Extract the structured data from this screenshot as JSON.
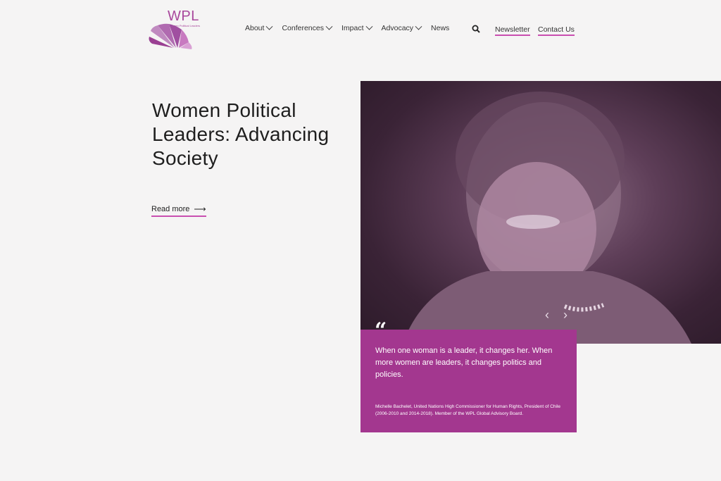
{
  "logo": {
    "text": "WPL",
    "subtitle": "Women Political Leaders",
    "brand_color": "#a8479c"
  },
  "nav": {
    "items": [
      {
        "label": "About",
        "has_dropdown": true
      },
      {
        "label": "Conferences",
        "has_dropdown": true
      },
      {
        "label": "Impact",
        "has_dropdown": true
      },
      {
        "label": "Advocacy",
        "has_dropdown": true
      },
      {
        "label": "News",
        "has_dropdown": false
      }
    ],
    "newsletter": "Newsletter",
    "contact": "Contact Us",
    "search_icon": "search-icon"
  },
  "hero": {
    "title": "Women Political Leaders: Advancing Society",
    "read_more": "Read more",
    "arrow": "⟶",
    "image_description_icon": "portrait-photo"
  },
  "carousel": {
    "prev": "‹",
    "next": "›"
  },
  "quote": {
    "mark": "“",
    "text": "When one woman is a leader, it changes her. When more women are leaders, it changes politics and policies.",
    "attribution": "Michelle Bachelet, United Nations High Commissioner for Human Rights, President of Chile (2006-2010 and 2014-2018). Member of the WPL Global Advisory Board.",
    "box_color": "#a3378f"
  },
  "colors": {
    "accent": "#c94fb0",
    "background": "#f5f4f4"
  }
}
